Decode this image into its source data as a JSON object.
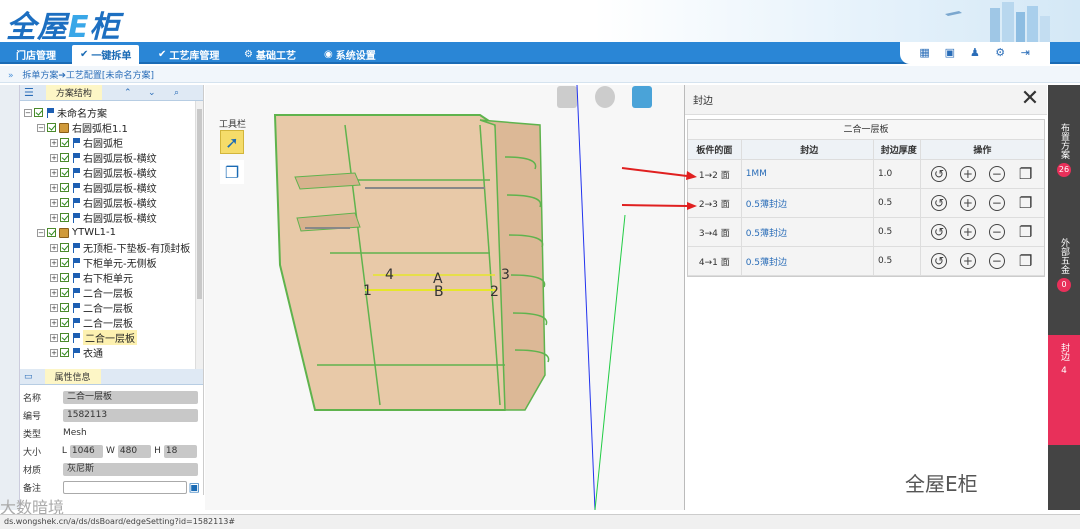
{
  "app": {
    "logo_text_a": "全屋",
    "logo_text_e": "E",
    "logo_text_b": "柜"
  },
  "nav": {
    "items": [
      {
        "label": "门店管理"
      },
      {
        "label": "一键拆单"
      },
      {
        "label": "工艺库管理"
      },
      {
        "label": "基础工艺"
      },
      {
        "label": "系统设置"
      }
    ],
    "right_icons": [
      "calculator-icon",
      "clipboard-icon",
      "user-icon",
      "gear-icon",
      "exit-icon"
    ]
  },
  "breadcrumb": {
    "text": "拆单方案➔工艺配置[未命名方案]"
  },
  "left_panel": {
    "tree_title": "方案结构",
    "tree": [
      {
        "level": 0,
        "label": "未命名方案",
        "icon": "flag"
      },
      {
        "level": 1,
        "label": "右圆弧柜1.1",
        "icon": "box"
      },
      {
        "level": 2,
        "label": "右圆弧柜",
        "icon": "flag"
      },
      {
        "level": 2,
        "label": "右圆弧层板-横纹",
        "icon": "flag"
      },
      {
        "level": 2,
        "label": "右圆弧层板-横纹",
        "icon": "flag"
      },
      {
        "level": 2,
        "label": "右圆弧层板-横纹",
        "icon": "flag"
      },
      {
        "level": 2,
        "label": "右圆弧层板-横纹",
        "icon": "flag"
      },
      {
        "level": 2,
        "label": "右圆弧层板-横纹",
        "icon": "flag"
      },
      {
        "level": 1,
        "label": "YTWL1-1",
        "icon": "box"
      },
      {
        "level": 2,
        "label": "无顶柜-下垫板-有顶封板",
        "icon": "flag"
      },
      {
        "level": 2,
        "label": "下柜单元-无侧板",
        "icon": "flag"
      },
      {
        "level": 2,
        "label": "右下柜单元",
        "icon": "flag"
      },
      {
        "level": 2,
        "label": "二合一层板",
        "icon": "flag"
      },
      {
        "level": 2,
        "label": "二合一层板",
        "icon": "flag"
      },
      {
        "level": 2,
        "label": "二合一层板",
        "icon": "flag"
      },
      {
        "level": 2,
        "label": "二合一层板",
        "icon": "flag",
        "selected": true
      },
      {
        "level": 2,
        "label": "衣通",
        "icon": "flag"
      }
    ],
    "props_title": "属性信息",
    "props": {
      "name_label": "名称",
      "name": "二合一层板",
      "id_label": "编号",
      "id": "1582113",
      "type_label": "类型",
      "type": "Mesh",
      "size_label": "大小",
      "L": "1046",
      "W": "480",
      "H": "18",
      "material_label": "材质",
      "material": "灰尼斯",
      "note_label": "备注",
      "note": ""
    }
  },
  "viewport": {
    "toolbar_label": "工具栏",
    "edge_labels": [
      "1",
      "2",
      "3",
      "4",
      "A",
      "B"
    ]
  },
  "dialog": {
    "title": "封边",
    "caption": "二合一层板",
    "headers": [
      "板件的面",
      "封边",
      "封边厚度",
      "操作"
    ],
    "rows": [
      {
        "face": "1→2 面",
        "edge": "1MM",
        "thickness": "1.0"
      },
      {
        "face": "2→3 面",
        "edge": "0.5薄封边",
        "thickness": "0.5"
      },
      {
        "face": "3→4 面",
        "edge": "0.5薄封边",
        "thickness": "0.5"
      },
      {
        "face": "4→1 面",
        "edge": "0.5薄封边",
        "thickness": "0.5"
      }
    ]
  },
  "right_rail": [
    {
      "label": "布置方案",
      "count": "26"
    },
    {
      "label": "外部五金",
      "count": "0"
    },
    {
      "label": "封边",
      "count": "4"
    }
  ],
  "status": {
    "url": "ds.wongshek.cn/a/ds/dsBoard/edgeSetting?id=1582113#"
  },
  "watermarks": {
    "left": "大数暗境",
    "right": "全屋E柜"
  }
}
